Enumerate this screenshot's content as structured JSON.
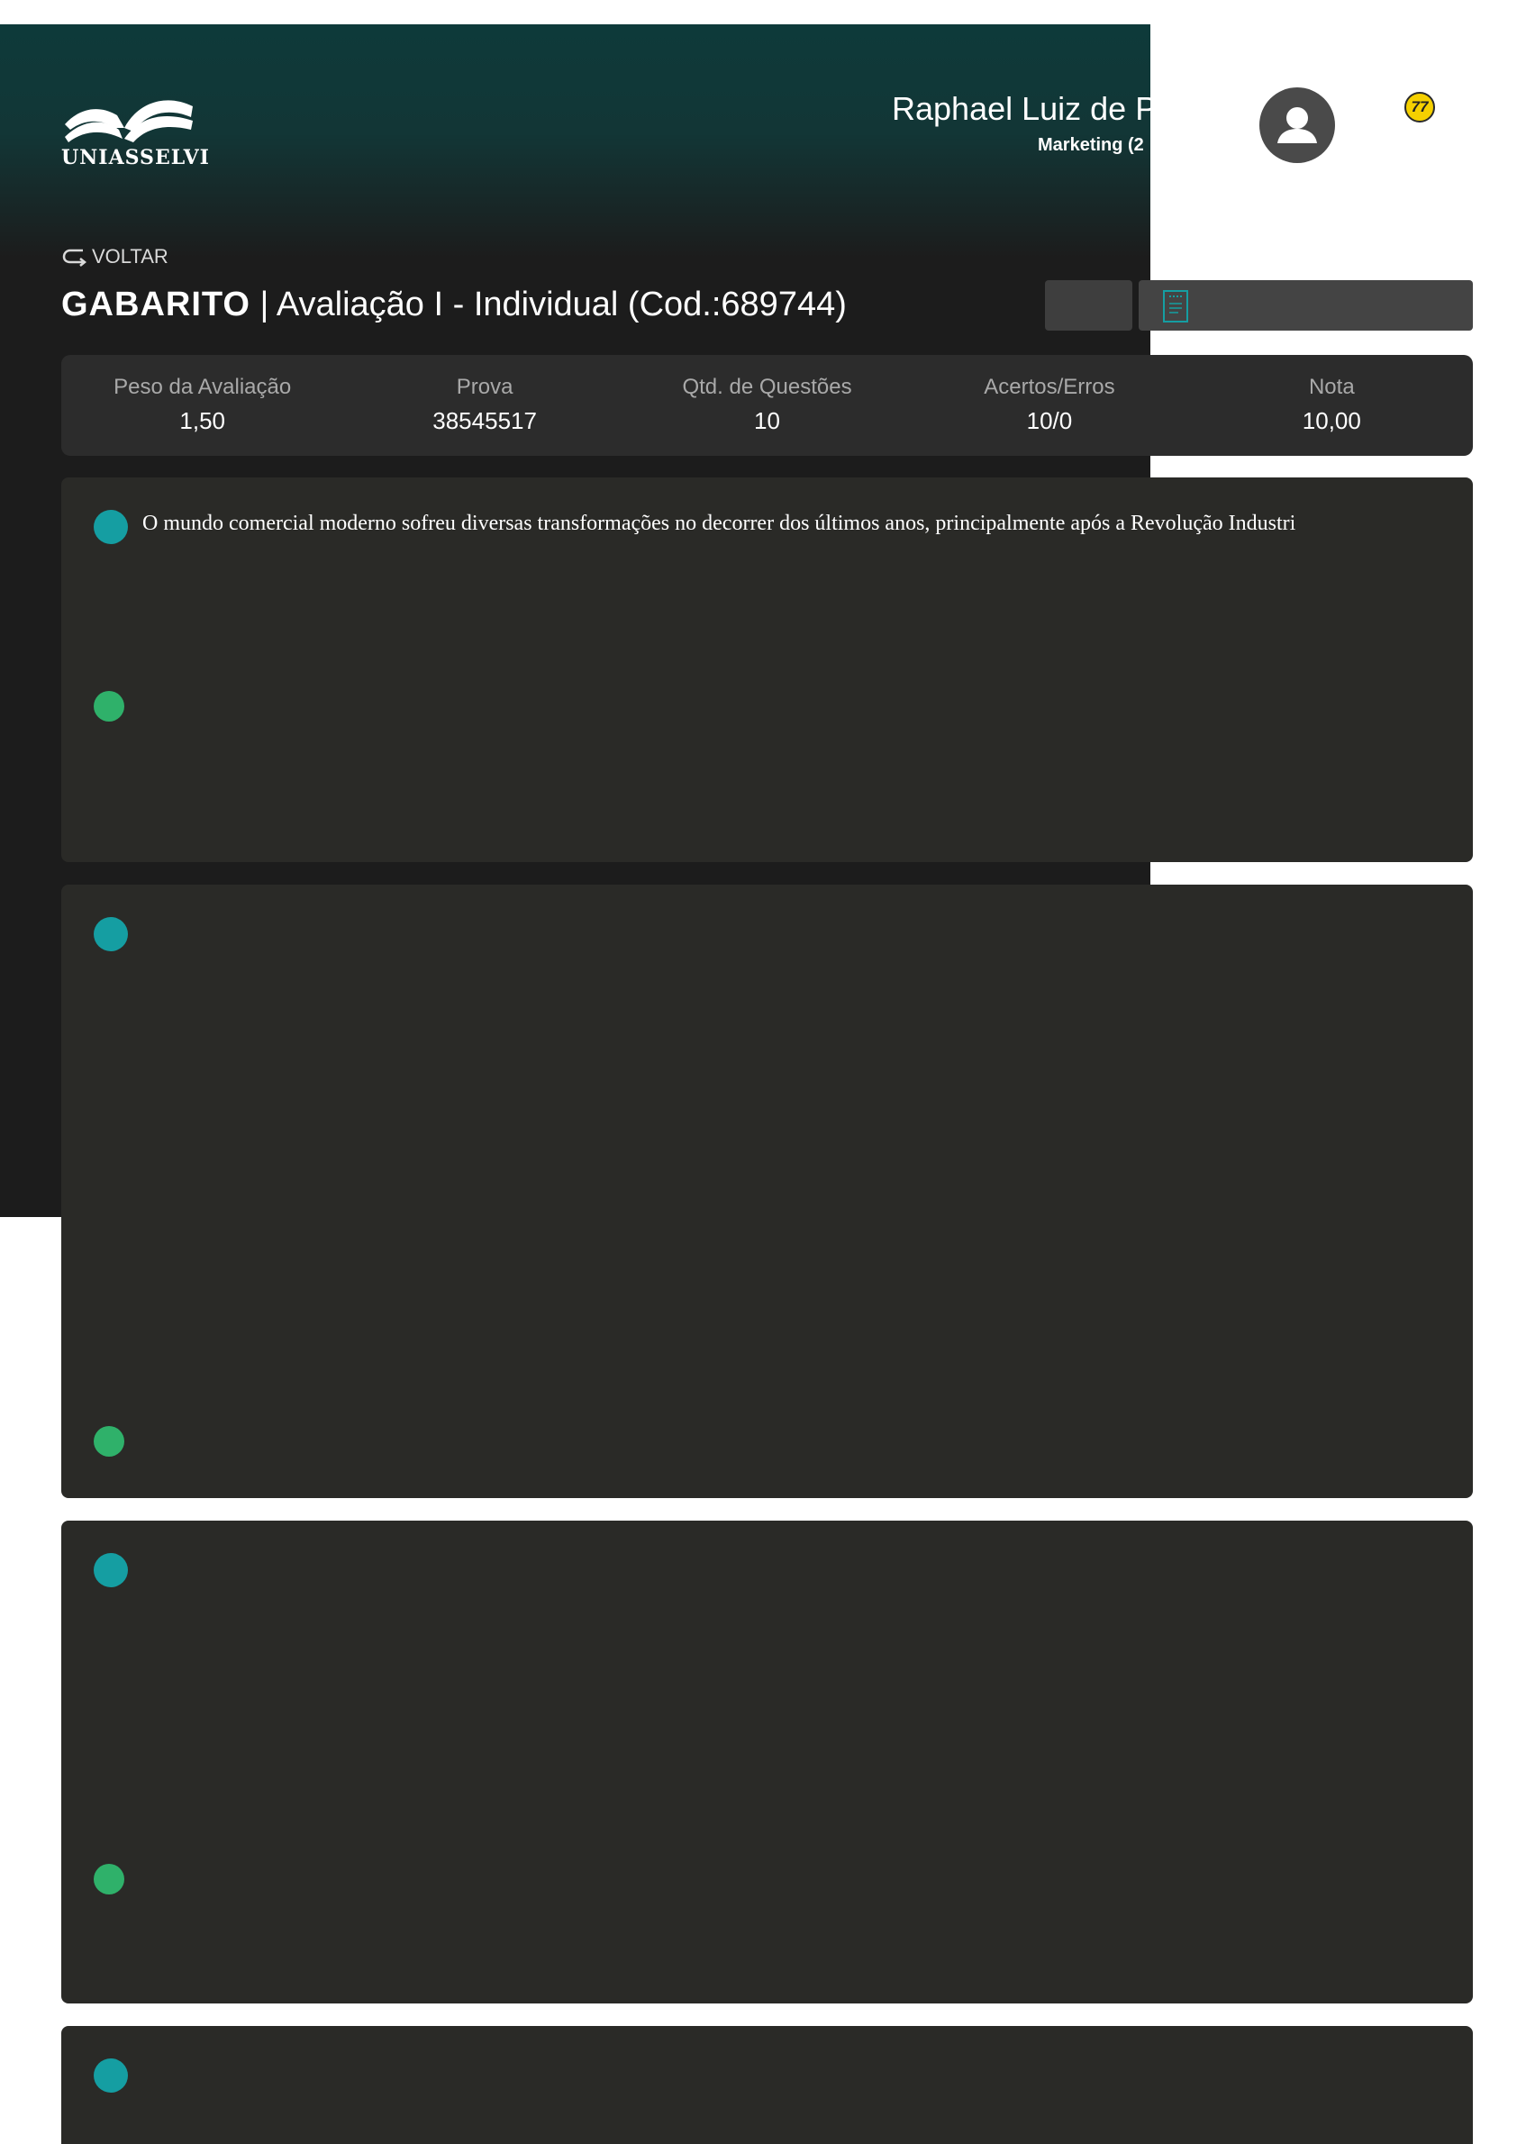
{
  "header": {
    "logo_text": "UNIASSELVI",
    "user_name": "Raphael Luiz de Pau",
    "user_course": "Marketing (2",
    "badge_count": "77"
  },
  "nav": {
    "back_label": "VOLTAR"
  },
  "page": {
    "title_strong": "GABARITO",
    "title_rest": " | Avaliação I - Individual (Cod.:689744)"
  },
  "summary": {
    "items": [
      {
        "label": "Peso da Avaliação",
        "value": "1,50"
      },
      {
        "label": "Prova",
        "value": "38545517"
      },
      {
        "label": "Qtd. de Questões",
        "value": "10"
      },
      {
        "label": "Acertos/Erros",
        "value": "10/0"
      },
      {
        "label": "Nota",
        "value": "10,00"
      }
    ]
  },
  "questions": [
    {
      "text": "O mundo comercial moderno sofreu diversas transformações no decorrer dos últimos anos, principalmente após a Revolução Industri"
    },
    {
      "text": ""
    },
    {
      "text": ""
    },
    {
      "text": ""
    }
  ],
  "colors": {
    "question_marker": "#159ea2",
    "answer_marker": "#2fb16a",
    "badge": "#f5d000"
  }
}
